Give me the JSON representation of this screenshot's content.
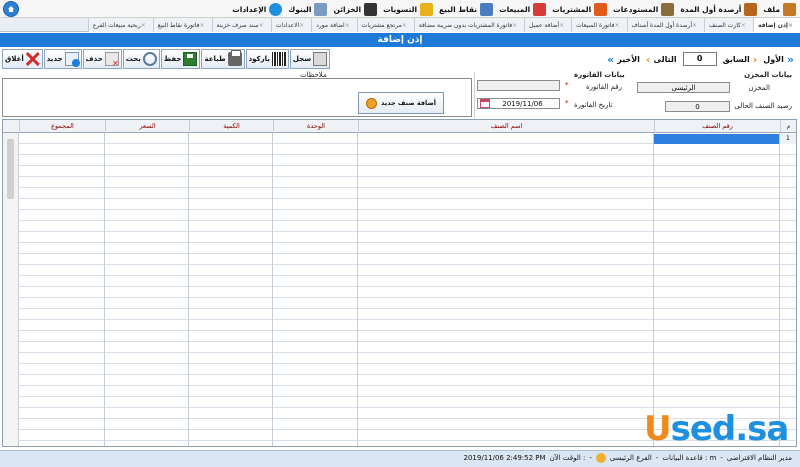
{
  "menu": {
    "items": [
      {
        "label": "ملف",
        "icon": "folder-icon",
        "color": "#c47a24"
      },
      {
        "label": "أرصدة أول المدة",
        "icon": "box-icon",
        "color": "#b5651d"
      },
      {
        "label": "المستودعات",
        "icon": "warehouse-icon",
        "color": "#8a6d3b"
      },
      {
        "label": "المشتريات",
        "icon": "cart-icon",
        "color": "#e05a1c"
      },
      {
        "label": "المبيعات",
        "icon": "cart-sales-icon",
        "color": "#d93a3a"
      },
      {
        "label": "نقاط البيع",
        "icon": "monitor-icon",
        "color": "#4a7cc0"
      },
      {
        "label": "التسويات",
        "icon": "folder-yellow-icon",
        "color": "#e8b11c"
      },
      {
        "label": "الخزائن",
        "icon": "safe-icon",
        "color": "#333333"
      },
      {
        "label": "البنوك",
        "icon": "bank-icon",
        "color": "#7a9bbf"
      },
      {
        "label": "الإعدادات",
        "icon": "settings-icon",
        "color": "#1d8fe0"
      }
    ]
  },
  "tabs": [
    {
      "label": "إذن إضافة",
      "active": true
    },
    {
      "label": "كارت الصنف",
      "active": false
    },
    {
      "label": "أرصدة أول المدة أصناف",
      "active": false
    },
    {
      "label": "فاتورة المبيعات",
      "active": false
    },
    {
      "label": "أضافة عميل",
      "active": false
    },
    {
      "label": "فاتورة المشتريات بدون ضريبة مضافة",
      "active": false
    },
    {
      "label": "مرتجع مشتريات",
      "active": false
    },
    {
      "label": "اضافة مورد",
      "active": false
    },
    {
      "label": "الاعدادات",
      "active": false
    },
    {
      "label": "سند صرف خزينة",
      "active": false
    },
    {
      "label": "فاتورة نقاط البيع",
      "active": false
    },
    {
      "label": "ربحية مبيعات الفرع",
      "active": false
    }
  ],
  "title": "إذن إضافة",
  "toolbar": {
    "close": "أغلاق",
    "new": "جديد",
    "delete": "حذف",
    "search": "بحث",
    "save": "حفظ",
    "print": "طباعة",
    "barcode": "باركود",
    "record": "سجل"
  },
  "nav": {
    "first": "الأول",
    "prev": "السابق",
    "record_no": "0",
    "next": "التالى",
    "last": "الأخير"
  },
  "store": {
    "section": "بيانات المخزن",
    "store_label": "المخزن",
    "store_value": "الرئيسى",
    "balance_label": "رصيد الصنف الحالى",
    "balance_value": "0"
  },
  "invoice": {
    "section": "بيانات الفاتورة",
    "number_label": "رقم الفاتورة",
    "number_value": "",
    "date_label": "تاريخ الفاتورة",
    "date_value": "2019/11/06"
  },
  "notes_label": "ملاحظات",
  "add_item_button": "أضافة صنف جديد",
  "grid": {
    "row_marker_header": "م",
    "columns": [
      "رقم الصنف",
      "اسم الصنف",
      "الوحدة",
      "الكمية",
      "السعر",
      "المجموع"
    ],
    "first_row_number": "1"
  },
  "watermark": {
    "u": "U",
    "rest": "sed.sa"
  },
  "status": {
    "admin": "مدير النظام الافتراضى",
    "db": "قاعدة البيانات : m",
    "branch": "الفرع الرئيسى",
    "time_label": "الوقت الآن :",
    "time_value": "2019/11/06 2:49:52 PM"
  },
  "colors": {
    "accent": "#1e7ad6",
    "header_text": "#8b0000",
    "selection": "#2d7fe0"
  }
}
